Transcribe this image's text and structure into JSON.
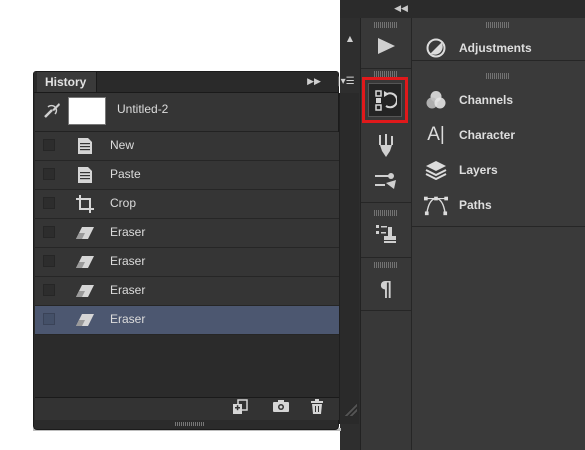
{
  "history_panel": {
    "tab_label": "History",
    "snapshot": {
      "label": "Untitled-2"
    },
    "states": [
      {
        "label": "New",
        "icon": "document-icon",
        "selected": false
      },
      {
        "label": "Paste",
        "icon": "document-icon",
        "selected": false
      },
      {
        "label": "Crop",
        "icon": "crop-icon",
        "selected": false
      },
      {
        "label": "Eraser",
        "icon": "eraser-icon",
        "selected": false
      },
      {
        "label": "Eraser",
        "icon": "eraser-icon",
        "selected": false
      },
      {
        "label": "Eraser",
        "icon": "eraser-icon",
        "selected": false
      },
      {
        "label": "Eraser",
        "icon": "eraser-icon",
        "selected": true
      }
    ],
    "footer_buttons": [
      "new-document-from-state-icon",
      "camera-icon",
      "trash-icon"
    ]
  },
  "dock": {
    "items": [
      {
        "label": "Adjustments",
        "icon": "adjustments-icon"
      },
      {
        "label": "Channels",
        "icon": "channels-icon"
      },
      {
        "label": "Character",
        "icon": "character-icon"
      },
      {
        "label": "Layers",
        "icon": "layers-icon"
      },
      {
        "label": "Paths",
        "icon": "paths-icon"
      }
    ],
    "icon_strip": [
      "play-icon",
      "history-icon",
      "brush-presets-icon",
      "tool-presets-icon",
      "clone-source-icon",
      "paragraph-icon"
    ]
  },
  "colors": {
    "selection": "#4c5770",
    "highlight": "#e0191b",
    "panel": "#353535"
  }
}
